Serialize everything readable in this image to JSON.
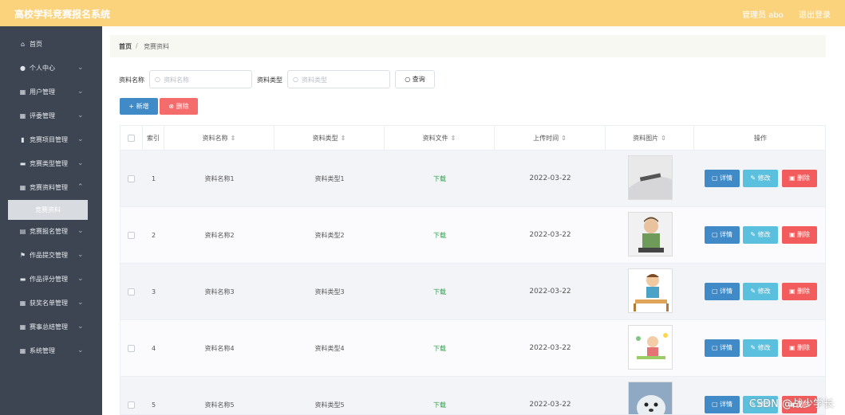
{
  "header": {
    "app_title": "高校学科竞赛报名系统",
    "user_label": "管理员 abo",
    "logout_label": "退出登录"
  },
  "sidebar": {
    "items": [
      {
        "label": "首页",
        "icon": "home-icon"
      },
      {
        "label": "个人中心",
        "icon": "person-icon"
      },
      {
        "label": "用户管理",
        "icon": "grid-icon"
      },
      {
        "label": "评委管理",
        "icon": "grid-icon"
      },
      {
        "label": "竞赛项目管理",
        "icon": "bar-chart-icon"
      },
      {
        "label": "竞赛类型管理",
        "icon": "folder-icon"
      },
      {
        "label": "竞赛资料管理",
        "icon": "grid-icon"
      },
      {
        "label": "竞赛报名管理",
        "icon": "document-icon"
      },
      {
        "label": "作品提交管理",
        "icon": "flag-icon"
      },
      {
        "label": "作品评分管理",
        "icon": "chat-icon"
      },
      {
        "label": "获奖名单管理",
        "icon": "grid-icon"
      },
      {
        "label": "赛事总结管理",
        "icon": "grid-icon"
      },
      {
        "label": "系统管理",
        "icon": "grid-icon"
      }
    ],
    "active_sub": "竞赛资料"
  },
  "breadcrumb": {
    "home": "首页",
    "separator": "/",
    "current": "竞赛资料"
  },
  "filters": {
    "name_label": "资料名称",
    "name_placeholder": "资料名称",
    "type_label": "资料类型",
    "type_placeholder": "资料类型",
    "query_label": "查询"
  },
  "toolbar": {
    "add_label": "+ 新增",
    "delete_label": "删除"
  },
  "table": {
    "columns": [
      "索引",
      "资料名称",
      "资料类型",
      "资料文件",
      "上传时间",
      "资料图片",
      "操作"
    ],
    "rows": [
      {
        "index": "1",
        "name": "资料名称1",
        "type": "资料类型1",
        "file": "下载",
        "date": "2022-03-22"
      },
      {
        "index": "2",
        "name": "资料名称2",
        "type": "资料类型2",
        "file": "下载",
        "date": "2022-03-22"
      },
      {
        "index": "3",
        "name": "资料名称3",
        "type": "资料类型3",
        "file": "下载",
        "date": "2022-03-22"
      },
      {
        "index": "4",
        "name": "资料名称4",
        "type": "资料类型4",
        "file": "下载",
        "date": "2022-03-22"
      },
      {
        "index": "5",
        "name": "资料名称5",
        "type": "资料类型5",
        "file": "下载",
        "date": "2022-03-22"
      }
    ],
    "actions": {
      "detail": "详情",
      "edit": "修改",
      "delete": "删除"
    }
  },
  "watermark": "CSDN @战少学长",
  "colors": {
    "header": "#fcd37d",
    "sidebar": "#3d4553",
    "primary": "#3f8ac7",
    "danger": "#f56c6c",
    "info": "#5bc0de",
    "download": "#2e9d4a"
  }
}
